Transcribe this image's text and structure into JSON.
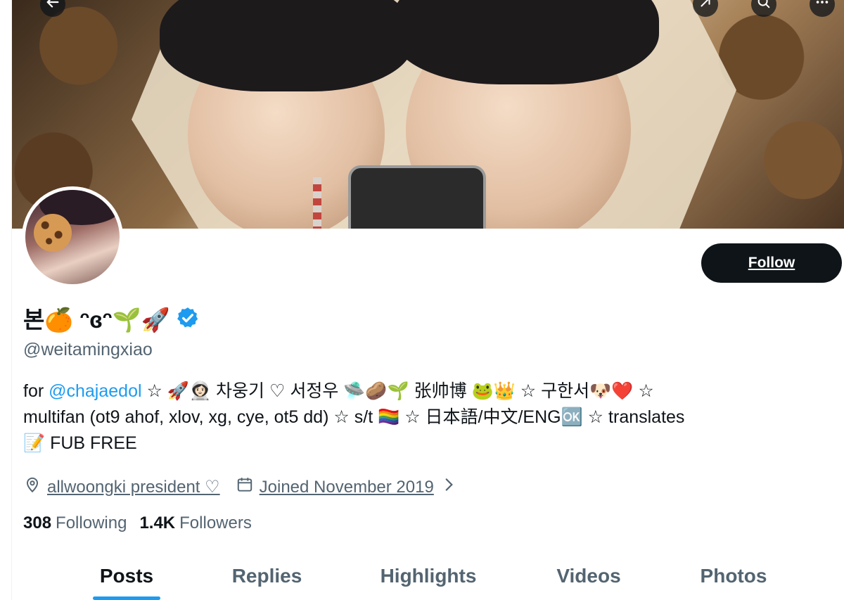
{
  "profile": {
    "display_name": "본🍊 ᵔɞᵔ🌱🚀",
    "handle": "@weitamingxiao",
    "follow_label": "Follow",
    "verified": true,
    "accent_color": "#1d9bf0"
  },
  "bio": {
    "line1_pre": "for ",
    "mention": "@chajaedol",
    "line1_post": " ☆ 🚀👩🏻‍🚀 차웅기 ♡ 서정우 🛸🥔🌱 张帅博 🐸👑 ☆ 구한서🐶❤️ ☆",
    "line2": "multifan (ot9 ahof, xlov, xg, cye, ot5 dd) ☆ s/t 🏳️‍🌈 ☆ 日本語/中文/ENG🆗 ☆ translates",
    "line3": "📝 FUB FREE"
  },
  "meta": {
    "location": "allwoongki president ♡",
    "joined": "Joined November 2019"
  },
  "stats": {
    "following_count": "308",
    "following_label": "Following",
    "followers_count": "1.4K",
    "followers_label": "Followers"
  },
  "tabs": [
    {
      "label": "Posts",
      "active": true
    },
    {
      "label": "Replies",
      "active": false
    },
    {
      "label": "Highlights",
      "active": false
    },
    {
      "label": "Videos",
      "active": false
    },
    {
      "label": "Photos",
      "active": false
    }
  ],
  "icons": {
    "back": "arrow-left-icon",
    "spaces": "share-icon",
    "search": "search-icon",
    "more": "more-icon",
    "location": "location-pin-icon",
    "calendar": "calendar-icon",
    "chevron": "chevron-right-icon"
  }
}
